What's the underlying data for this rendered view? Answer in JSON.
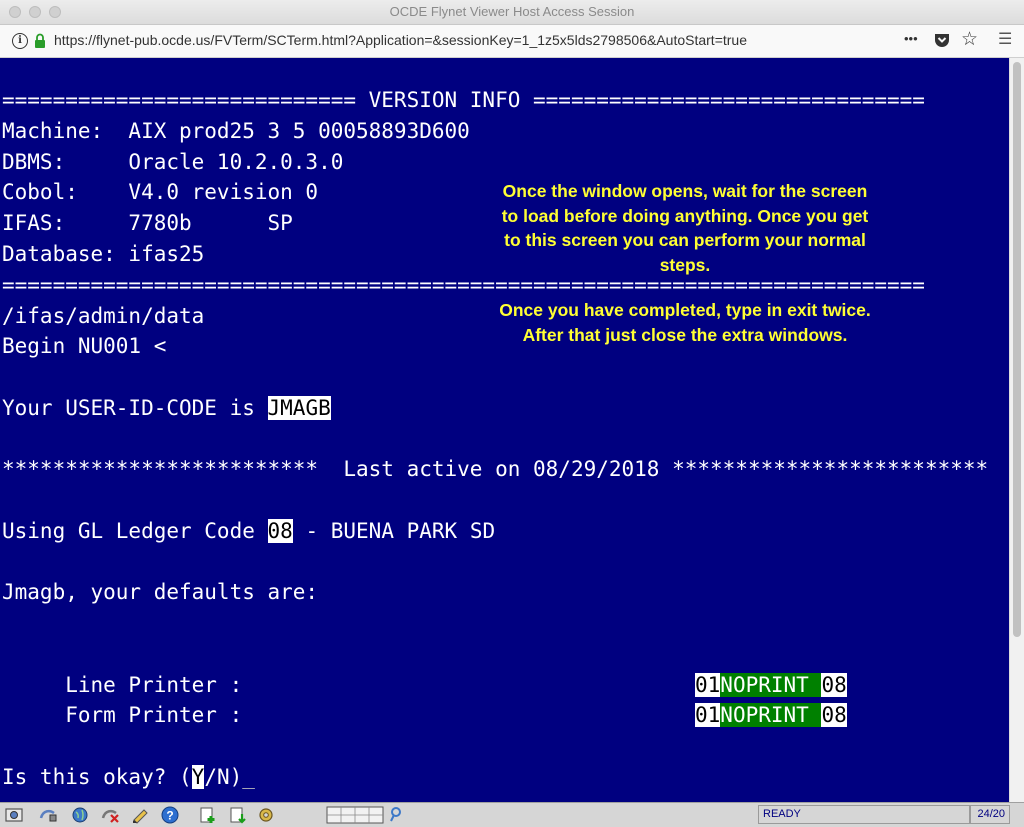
{
  "window": {
    "title": "OCDE Flynet Viewer Host Access Session"
  },
  "browser": {
    "url": "https://flynet-pub.ocde.us/FVTerm/SCTerm.html?Application=&sessionKey=1_1z5x5lds2798506&AutoStart=true",
    "info_symbol": "i",
    "more_symbol": "•••",
    "star_symbol": "☆",
    "menu_symbol": "☰"
  },
  "terminal": {
    "lines": [
      "============================ VERSION INFO ===============================",
      "Machine:  AIX prod25 3 5 00058893D600",
      "DBMS:     Oracle 10.2.0.3.0",
      "Cobol:    V4.0 revision 0",
      "IFAS:     7780b      SP",
      "Database: ifas25",
      "=========================================================================",
      "/ifas/admin/data",
      "Begin NU001 <"
    ],
    "user_id_prefix": "Your USER-ID-CODE is ",
    "user_id": "JMAGB",
    "stars_left": "*************************",
    "last_active": "  Last active on 08/29/2018 ",
    "stars_right": "*************************",
    "ledger_prefix": "Using GL Ledger Code ",
    "ledger_code": "08",
    "ledger_suffix": " - BUENA PARK SD",
    "defaults_line": "Jmagb, your defaults are:",
    "line_printer_label": "     Line Printer :",
    "form_printer_label": "     Form Printer :",
    "printer_prefix": "01",
    "printer_name": "NOPRINT ",
    "printer_suffix": "08",
    "prompt_prefix": "Is this okay? (",
    "prompt_cursor": "Y",
    "prompt_suffix": "/N)",
    "prompt_underscore": "_"
  },
  "notes": {
    "note1_l1": "Once the window opens, wait for the screen",
    "note1_l2": "to load before doing anything.  Once you get",
    "note1_l3": "to this screen you can perform your normal",
    "note1_l4": "steps.",
    "note2_l1": "Once you have completed, type in exit twice.",
    "note2_l2": "After that just close the extra windows."
  },
  "statusbar": {
    "ready": "READY",
    "position": "24/20"
  },
  "colors": {
    "terminal_bg": "#000080",
    "note_text": "#ffff33",
    "field_green": "#008000"
  }
}
